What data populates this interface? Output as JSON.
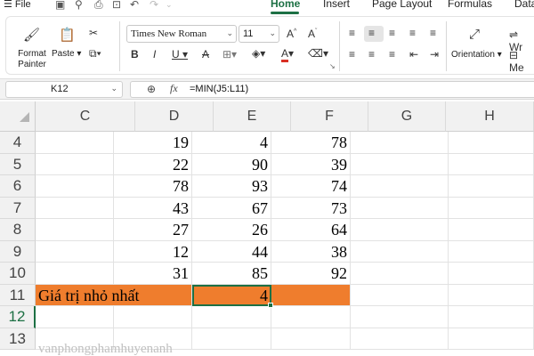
{
  "menubar": {
    "file_icon": "hamburger-icon",
    "file_label": "File",
    "tabs": [
      "Home",
      "Insert",
      "Page Layout",
      "Formulas",
      "Data"
    ],
    "active_tab": "Home"
  },
  "ribbon": {
    "format_painter_label": "Format\nPainter",
    "paste_label": "Paste",
    "font_name": "Times New Roman",
    "font_size": "11",
    "orientation_label": "Orientation",
    "wrap_label": "Wr",
    "merge_label": "Me"
  },
  "formula_bar": {
    "name_box": "K12",
    "fx_label": "fx",
    "formula": "=MIN(J5:L11)"
  },
  "sheet": {
    "columns": [
      "C",
      "D",
      "E",
      "F",
      "G",
      "H"
    ],
    "rows": [
      "4",
      "5",
      "6",
      "7",
      "8",
      "9",
      "10",
      "11",
      "12",
      "13"
    ],
    "data": [
      [
        "19",
        "4",
        "78"
      ],
      [
        "22",
        "90",
        "39"
      ],
      [
        "78",
        "93",
        "74"
      ],
      [
        "43",
        "67",
        "73"
      ],
      [
        "27",
        "26",
        "64"
      ],
      [
        "12",
        "44",
        "38"
      ],
      [
        "31",
        "85",
        "92"
      ]
    ],
    "summary_label": "Giá trị nhỏ nhất",
    "summary_value": "4",
    "highlight_color": "#ef7d2d",
    "accent_color": "#1d7044"
  },
  "watermark": "vanphongphamhuyenanh"
}
